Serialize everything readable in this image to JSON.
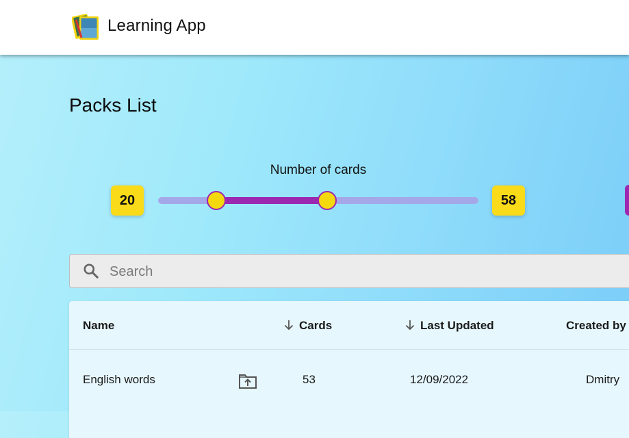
{
  "app": {
    "title": "Learning App"
  },
  "page": {
    "title": "Packs List"
  },
  "cards_filter": {
    "label": "Number of cards",
    "min_value": "20",
    "max_value": "58",
    "range_low_fraction": 0.18,
    "range_high_fraction": 0.525
  },
  "search": {
    "placeholder": "Search",
    "value": ""
  },
  "table": {
    "columns": {
      "name": "Name",
      "cards": "Cards",
      "last_updated": "Last Updated",
      "created_by": "Created by"
    },
    "rows": [
      {
        "name": "English words",
        "action_icon": "folder-upload-icon",
        "cards": "53",
        "last_updated": "12/09/2022",
        "created_by": "Dmitry"
      }
    ]
  },
  "colors": {
    "accent_purple": "#9c27b0",
    "highlight_yellow": "#fadb1a",
    "rail_lavender": "#a5a8e8"
  }
}
